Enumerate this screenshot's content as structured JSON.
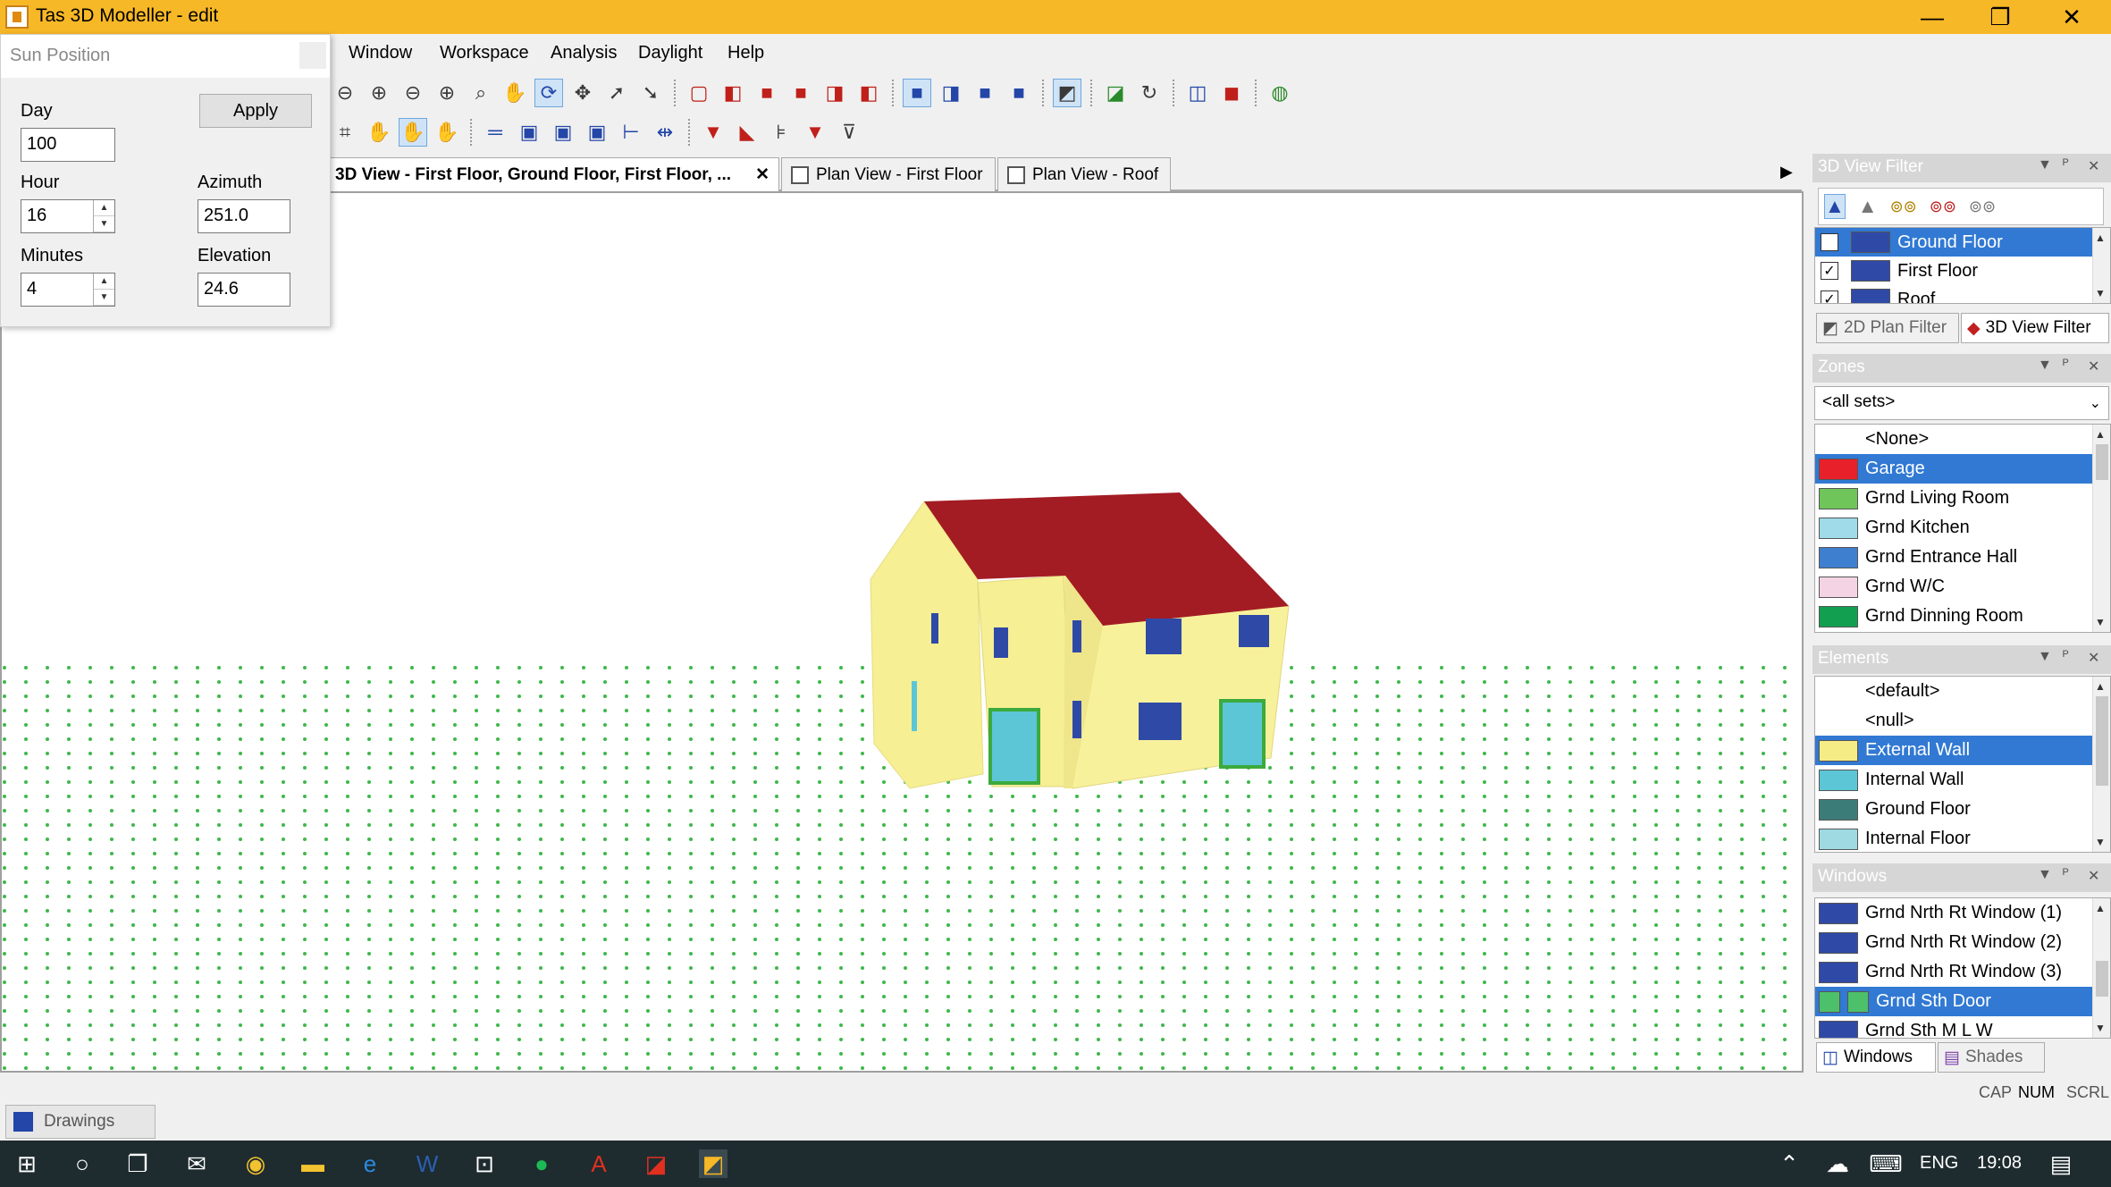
{
  "window": {
    "title": "Tas 3D Modeller - edit",
    "minimize_glyph": "—",
    "restore_glyph": "❐",
    "close_glyph": "✕"
  },
  "menu": [
    "Window",
    "Workspace",
    "Analysis",
    "Daylight",
    "Help"
  ],
  "sun_position": {
    "title": "Sun Position",
    "day_label": "Day",
    "day_value": "100",
    "apply_label": "Apply",
    "hour_label": "Hour",
    "hour_value": "16",
    "azimuth_label": "Azimuth",
    "azimuth_value": "251.0",
    "minutes_label": "Minutes",
    "minutes_value": "4",
    "elevation_label": "Elevation",
    "elevation_value": "24.6"
  },
  "tabs": [
    {
      "label": "3D View - First Floor, Ground Floor, First Floor, ...",
      "active": true
    },
    {
      "label": "Plan View - First Floor",
      "active": false
    },
    {
      "label": "Plan View - Roof",
      "active": false
    }
  ],
  "view_filter": {
    "title": "3D View Filter",
    "items": [
      {
        "label": "Ground Floor",
        "color": "#2f4aa6",
        "selected": true
      },
      {
        "label": "First Floor",
        "color": "#2f4aa6",
        "selected": false
      },
      {
        "label": "Roof",
        "color": "#2f4aa6",
        "selected": false
      }
    ],
    "tab_2d": "2D Plan Filter",
    "tab_3d": "3D View Filter"
  },
  "zones": {
    "title": "Zones",
    "set_value": "<all sets>",
    "items": [
      {
        "label": "<None>",
        "color": null,
        "selected": false
      },
      {
        "label": "Garage",
        "color": "#e8202a",
        "selected": true
      },
      {
        "label": "Grnd Living Room",
        "color": "#6fc45a",
        "selected": false
      },
      {
        "label": "Grnd Kitchen",
        "color": "#9fdbe8",
        "selected": false
      },
      {
        "label": "Grnd Entrance Hall",
        "color": "#3f7fcf",
        "selected": false
      },
      {
        "label": "Grnd W/C",
        "color": "#f4d4e4",
        "selected": false
      },
      {
        "label": "Grnd Dinning Room",
        "color": "#12a050",
        "selected": false
      }
    ]
  },
  "elements": {
    "title": "Elements",
    "items": [
      {
        "label": "<default>",
        "color": null,
        "selected": false
      },
      {
        "label": "<null>",
        "color": null,
        "selected": false
      },
      {
        "label": "External Wall",
        "color": "#f5ec86",
        "selected": true
      },
      {
        "label": "Internal Wall",
        "color": "#5cc6d6",
        "selected": false
      },
      {
        "label": "Ground Floor",
        "color": "#3c7c78",
        "selected": false
      },
      {
        "label": "Internal Floor",
        "color": "#9fd9e2",
        "selected": false
      }
    ]
  },
  "windows": {
    "title": "Windows",
    "items": [
      {
        "label": "Grnd Nrth Rt Window (1)",
        "color": "#2f4aa6",
        "selected": false
      },
      {
        "label": "Grnd Nrth Rt Window (2)",
        "color": "#2f4aa6",
        "selected": false
      },
      {
        "label": "Grnd Nrth Rt Window (3)",
        "color": "#2f4aa6",
        "selected": false
      },
      {
        "label": "Grnd Sth Door",
        "color": "#4cc06a",
        "selected": true
      },
      {
        "label": "Grnd Sth M L W",
        "color": "#2f4aa6",
        "selected": false
      }
    ],
    "tab_windows": "Windows",
    "tab_shades": "Shades"
  },
  "status": {
    "cap": "CAP",
    "num": "NUM",
    "scrl": "SCRL",
    "drawings_tab": "Drawings"
  },
  "taskbar": {
    "lang": "ENG",
    "time": "19:08"
  },
  "colors": {
    "titlebar": "#f7b827",
    "selection": "#3179d3",
    "roof": "#a31c24",
    "wall": "#f6ef94",
    "grid_points": "#3fb84a"
  }
}
